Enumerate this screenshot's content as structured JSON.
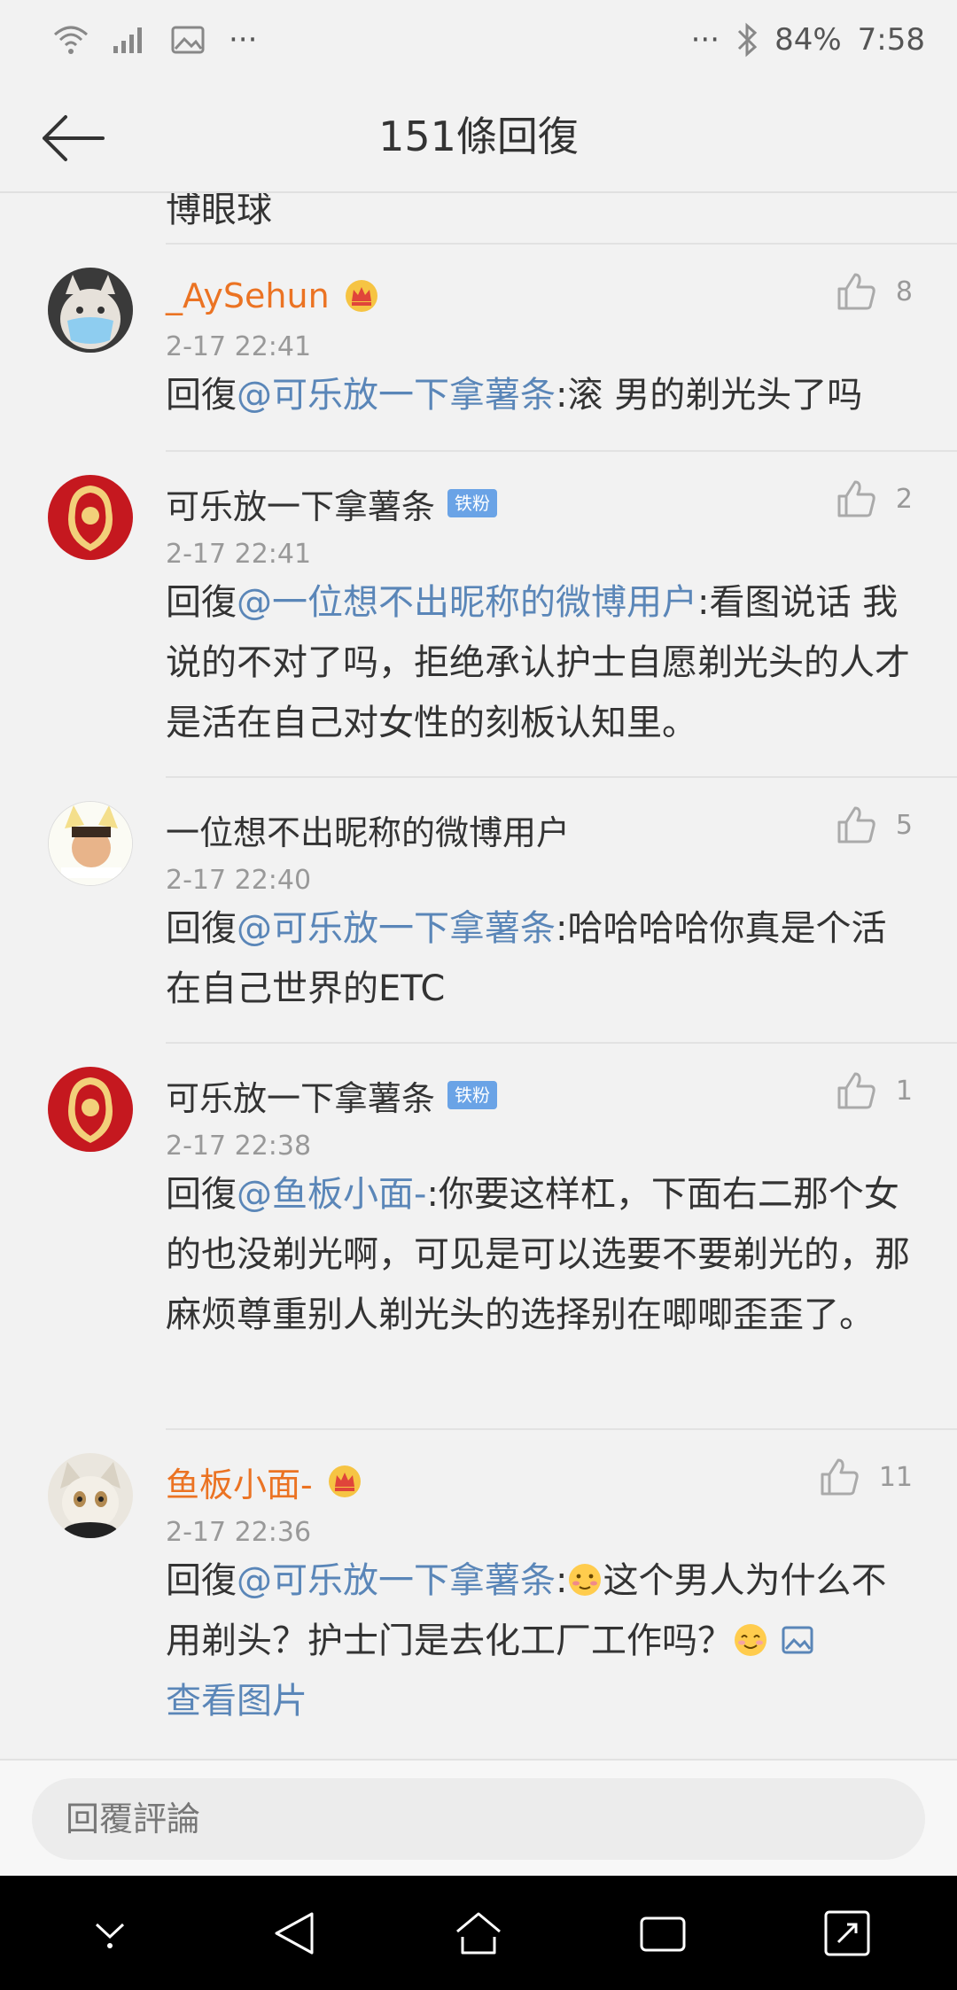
{
  "status_bar": {
    "battery": "84%",
    "time": "7:58",
    "more_left": "···",
    "more_right": "···"
  },
  "nav": {
    "title": "151條回復"
  },
  "partial_text": "博眼球",
  "comments": [
    {
      "username": "_AySehun",
      "vip": true,
      "badge": "",
      "time": "2-17 22:41",
      "likes": "8",
      "prefix": "回復",
      "mention": "@可乐放一下拿薯条",
      "text": ":滚 男的剃光头了吗"
    },
    {
      "username": "可乐放一下拿薯条",
      "vip": false,
      "badge": "铁粉",
      "time": "2-17 22:41",
      "likes": "2",
      "prefix": "回復",
      "mention": "@一位想不出昵称的微博用户",
      "text": ":看图说话 我说的不对了吗，拒绝承认护士自愿剃光头的人才是活在自己对女性的刻板认知里。"
    },
    {
      "username": "一位想不出昵称的微博用户",
      "vip": false,
      "badge": "",
      "time": "2-17 22:40",
      "likes": "5",
      "prefix": "回復",
      "mention": "@可乐放一下拿薯条",
      "text": ":哈哈哈哈你真是个活在自己世界的ETC"
    },
    {
      "username": "可乐放一下拿薯条",
      "vip": false,
      "badge": "铁粉",
      "time": "2-17 22:38",
      "likes": "1",
      "prefix": "回復",
      "mention": "@鱼板小面-",
      "text": ":你要这样杠，下面右二那个女的也没剃光啊，可见是可以选要不要剃光的，那麻烦尊重别人剃光头的选择别在唧唧歪歪了。"
    },
    {
      "username": "鱼板小面-",
      "vip": true,
      "badge": "",
      "time": "2-17 22:36",
      "likes": "11",
      "prefix": "回復",
      "mention": "@可乐放一下拿薯条",
      "text_a": ":",
      "text_b": "这个男人为什么不用剃头？护士门是去化工厂工作吗？",
      "view_image": "查看图片"
    }
  ],
  "reply": {
    "placeholder": "回覆評論"
  },
  "colors": {
    "mention": "#5a86b8",
    "vip_name": "#eb7323",
    "badge": "#6aa3e6"
  }
}
